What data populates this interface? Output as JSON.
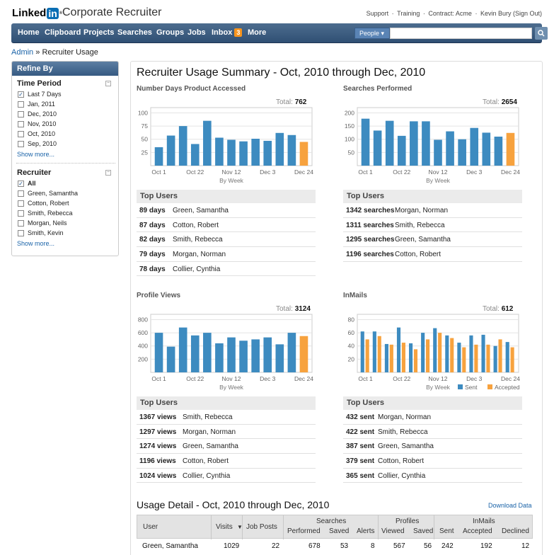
{
  "header": {
    "logo_text": "Linked",
    "logo_in": "in",
    "logo_reg": "®",
    "product": "Corporate Recruiter",
    "links": [
      "Support",
      "·",
      "Training",
      "·",
      "Contract: Acme",
      "·",
      "Kevin Bury (Sign Out)"
    ]
  },
  "nav": {
    "items": [
      "Home",
      "Clipboard",
      "Projects",
      "Searches",
      "Groups",
      "Jobs",
      "Inbox",
      "More"
    ],
    "inbox_badge": "3",
    "search_scope": "People ▾",
    "search_placeholder": "",
    "search_button_icon": "magnifier-icon"
  },
  "breadcrumb": {
    "parent": "Admin",
    "sep": "»",
    "current": "Recruiter Usage"
  },
  "sidebar": {
    "title": "Refine By",
    "time_period": {
      "label": "Time Period",
      "options": [
        {
          "label": "Last 7 Days",
          "checked": true
        },
        {
          "label": "Jan, 2011",
          "checked": false
        },
        {
          "label": "Dec, 2010",
          "checked": false
        },
        {
          "label": "Nov, 2010",
          "checked": false
        },
        {
          "label": "Oct, 2010",
          "checked": false
        },
        {
          "label": "Sep, 2010",
          "checked": false
        }
      ],
      "show_more": "Show more..."
    },
    "recruiter": {
      "label": "Recruiter",
      "options": [
        {
          "label": "All",
          "checked": true
        },
        {
          "label": "Green, Samantha",
          "checked": false
        },
        {
          "label": "Cotton, Robert",
          "checked": false
        },
        {
          "label": "Smith, Rebecca",
          "checked": false
        },
        {
          "label": "Morgan, Neils",
          "checked": false
        },
        {
          "label": "Smith, Kevin",
          "checked": false
        }
      ],
      "show_more": "Show more..."
    }
  },
  "main": {
    "title": "Recruiter Usage Summary - Oct, 2010 through Dec, 2010"
  },
  "colors": {
    "bar_blue": "#3d8bc0",
    "bar_orange": "#f7a23e",
    "nav": "#3b5b80"
  },
  "chart_data": [
    {
      "type": "bar",
      "title": "Number Days Product Accessed",
      "total_label": "Total:",
      "total": "762",
      "xlabel": "By Week",
      "xticks": [
        "Oct 1",
        "Oct 22",
        "Nov 12",
        "Dec 3",
        "Dec 24"
      ],
      "yticks": [
        25,
        50,
        75,
        100
      ],
      "ylim": [
        0,
        110
      ],
      "values": [
        35,
        57,
        75,
        41,
        85,
        53,
        49,
        46,
        51,
        47,
        62,
        58,
        45
      ]
    },
    {
      "type": "bar",
      "title": "Searches Performed",
      "total_label": "Total:",
      "total": "2654",
      "xlabel": "By Week",
      "xticks": [
        "Oct 1",
        "Oct 22",
        "Nov 12",
        "Dec 3",
        "Dec 24"
      ],
      "yticks": [
        50,
        100,
        150,
        200
      ],
      "ylim": [
        0,
        220
      ],
      "values": [
        178,
        133,
        170,
        113,
        168,
        168,
        98,
        130,
        100,
        143,
        125,
        110,
        124
      ]
    },
    {
      "type": "bar",
      "title": "Profile Views",
      "total_label": "Total:",
      "total": "3124",
      "xlabel": "By Week",
      "xticks": [
        "Oct 1",
        "Oct 22",
        "Nov 12",
        "Dec 3",
        "Dec 24"
      ],
      "yticks": [
        200,
        400,
        600,
        800
      ],
      "ylim": [
        0,
        880
      ],
      "values": [
        600,
        390,
        680,
        560,
        600,
        440,
        530,
        480,
        500,
        530,
        425,
        600,
        550
      ]
    },
    {
      "type": "bar",
      "title": "InMails",
      "total_label": "Total:",
      "total": "612",
      "xlabel": "By Week",
      "xticks": [
        "Oct 1",
        "Oct 22",
        "Nov 12",
        "Dec 3",
        "Dec 24"
      ],
      "yticks": [
        20,
        40,
        60,
        80
      ],
      "ylim": [
        0,
        88
      ],
      "series": [
        {
          "name": "Sent",
          "values": [
            62,
            62,
            43,
            68,
            44,
            60,
            67,
            56,
            45,
            56,
            57,
            40,
            46
          ]
        },
        {
          "name": "Accepted",
          "values": [
            50,
            55,
            42,
            45,
            35,
            50,
            60,
            52,
            38,
            42,
            42,
            50,
            38
          ]
        }
      ]
    }
  ],
  "top_users": [
    {
      "title": "Top Users",
      "rows": [
        {
          "v": "89 days",
          "n": "Green, Samantha"
        },
        {
          "v": "87 days",
          "n": "Cotton, Robert"
        },
        {
          "v": "82 days",
          "n": "Smith, Rebecca"
        },
        {
          "v": "79 days",
          "n": "Morgan, Norman"
        },
        {
          "v": "78 days",
          "n": "Collier, Cynthia"
        }
      ]
    },
    {
      "title": "Top Users",
      "rows": [
        {
          "v": "1342 searches",
          "n": "Morgan, Norman"
        },
        {
          "v": "1311 searches",
          "n": "Smith, Rebecca"
        },
        {
          "v": "1295 searches",
          "n": "Green, Samantha"
        },
        {
          "v": "1196 searches",
          "n": "Cotton, Robert"
        }
      ]
    },
    {
      "title": "Top Users",
      "rows": [
        {
          "v": "1367 views",
          "n": "Smith, Rebecca"
        },
        {
          "v": "1297 views",
          "n": "Morgan, Norman"
        },
        {
          "v": "1274 views",
          "n": "Green, Samantha"
        },
        {
          "v": "1196 views",
          "n": "Cotton, Robert"
        },
        {
          "v": "1024 views",
          "n": "Collier, Cynthia"
        }
      ]
    },
    {
      "title": "Top Users",
      "rows": [
        {
          "v": "432 sent",
          "n": "Morgan, Norman"
        },
        {
          "v": "422 sent",
          "n": "Smith, Rebecca"
        },
        {
          "v": "387 sent",
          "n": "Green, Samantha"
        },
        {
          "v": "379 sent",
          "n": "Cotton, Robert"
        },
        {
          "v": "365 sent",
          "n": "Collier, Cynthia"
        }
      ]
    }
  ],
  "usage_detail": {
    "title": "Usage Detail - Oct, 2010 through Dec, 2010",
    "download": "Download Data",
    "headers": {
      "user": "User",
      "visits": "Visits",
      "job_posts": "Job Posts",
      "searches": "Searches",
      "performed": "Performed",
      "saved": "Saved",
      "alerts": "Alerts",
      "profiles": "Profiles",
      "viewed": "Viewed",
      "psaved": "Saved",
      "inmails": "InMails",
      "sent": "Sent",
      "accepted": "Accepted",
      "declined": "Declined"
    },
    "rows": [
      {
        "user": "Green, Samantha",
        "visits": "1029",
        "job_posts": "22",
        "performed": "678",
        "saved": "53",
        "alerts": "8",
        "viewed": "567",
        "psaved": "56",
        "sent": "242",
        "accepted": "192",
        "declined": "12"
      }
    ]
  }
}
